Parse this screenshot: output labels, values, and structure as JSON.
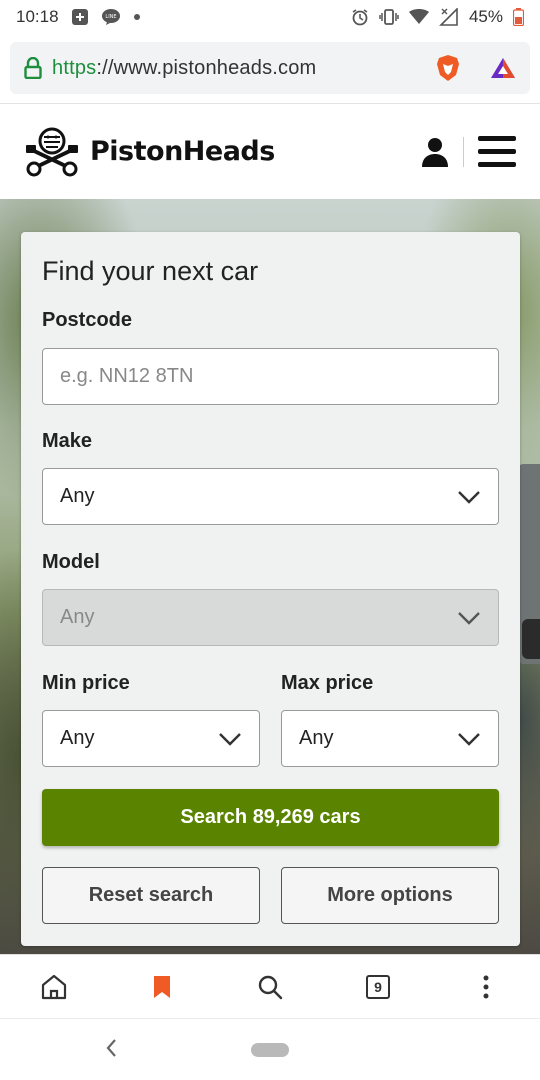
{
  "status_bar": {
    "time": "10:18",
    "battery": "45%",
    "notification_icons": [
      "plus-square-icon",
      "line-chat-icon",
      "dot-icon"
    ],
    "system_icons": [
      "alarm-icon",
      "vibrate-icon",
      "wifi-icon",
      "signal-icon",
      "battery-icon"
    ]
  },
  "browser": {
    "url_scheme": "https",
    "url_rest": "://www.pistonheads.com",
    "accent_color": "#1e8e3e",
    "tab_count": "9"
  },
  "site": {
    "logo_text": "PistonHeads"
  },
  "form": {
    "title": "Find your next car",
    "postcode_label": "Postcode",
    "postcode_placeholder": "e.g. NN12 8TN",
    "make_label": "Make",
    "make_value": "Any",
    "model_label": "Model",
    "model_value": "Any",
    "min_price_label": "Min price",
    "min_price_value": "Any",
    "max_price_label": "Max price",
    "max_price_value": "Any",
    "search_button": "Search 89,269 cars",
    "reset_button": "Reset search",
    "more_options_button": "More options",
    "primary_color": "#5a8300"
  }
}
